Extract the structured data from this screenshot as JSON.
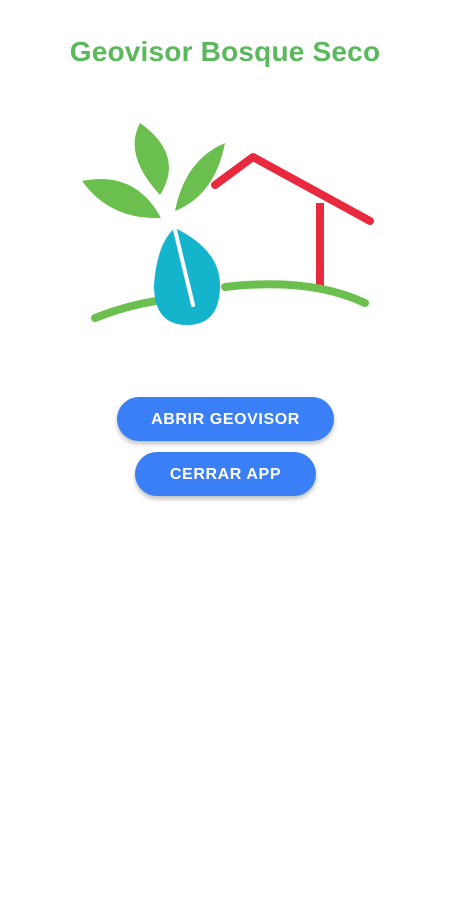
{
  "app": {
    "title": "Geovisor Bosque Seco"
  },
  "logo": {
    "icon": "bosque-seco-logo-icon",
    "colors": {
      "leaf": "#6bbf4e",
      "house": "#e8293e",
      "drop": "#14b4cc",
      "ground": "#6bbf4e"
    }
  },
  "actions": {
    "open_label": "ABRIR GEOVISOR",
    "close_label": "CERRAR APP"
  },
  "theme": {
    "title_color": "#5cb85c",
    "button_color": "#3a7ff6",
    "button_text_color": "#ffffff"
  }
}
